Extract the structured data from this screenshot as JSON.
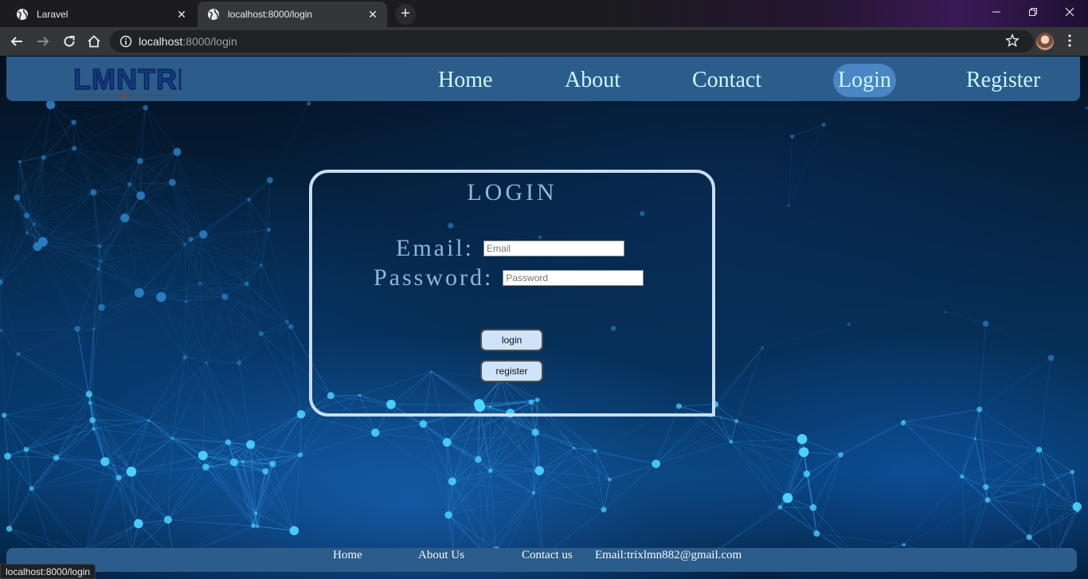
{
  "browser": {
    "tabs": [
      {
        "title": "Laravel",
        "active": false
      },
      {
        "title": "localhost:8000/login",
        "active": true
      }
    ],
    "new_tab": "+",
    "url_host": "localhost",
    "url_rest": ":8000/login",
    "status_text": "localhost:8000/login",
    "icons": [
      "back-arrow-icon",
      "forward-arrow-icon",
      "reload-icon",
      "home-icon",
      "info-icon",
      "star-icon",
      "profile-avatar",
      "kebab-menu-icon"
    ]
  },
  "site": {
    "logo_text": "LMNTRIX",
    "nav": [
      {
        "label": "Home",
        "active": false
      },
      {
        "label": "About",
        "active": false
      },
      {
        "label": "Contact",
        "active": false
      },
      {
        "label": "Login",
        "active": true
      },
      {
        "label": "Register",
        "active": false
      }
    ]
  },
  "login": {
    "title": "LOGIN",
    "email_label": "Email:",
    "email_placeholder": "Email",
    "password_label": "Password:",
    "password_placeholder": "Password",
    "login_button": "login",
    "register_button": "register"
  },
  "footer": {
    "links": [
      "Home",
      "About Us",
      "Contact us"
    ],
    "email": "Email:trixlmn882@gmail.com"
  },
  "colors": {
    "navbar": "#2b5c8a",
    "nav_text": "#ccf6ff",
    "active_pill": "#4a86c4",
    "card_border": "#c8ddf5",
    "label_text": "#8fb8d6",
    "button_bg": "#cfe4fb"
  }
}
